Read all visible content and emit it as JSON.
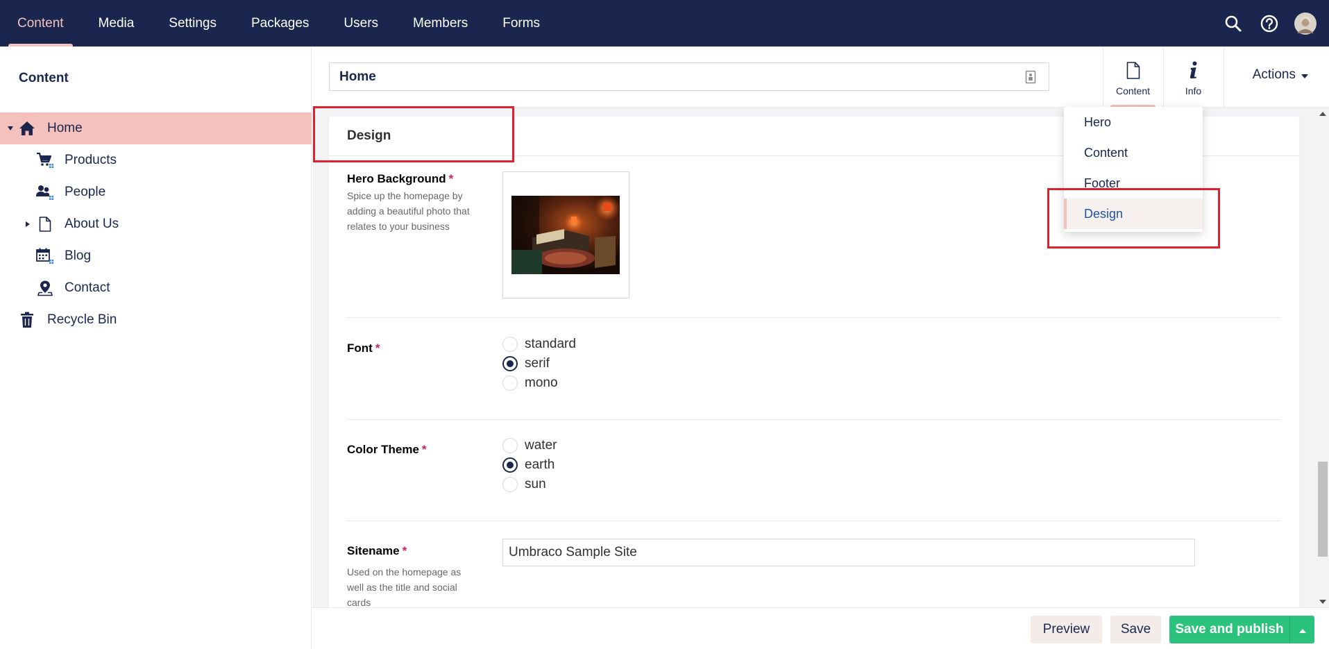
{
  "topnav": {
    "items": [
      {
        "label": "Content",
        "active": true
      },
      {
        "label": "Media"
      },
      {
        "label": "Settings"
      },
      {
        "label": "Packages"
      },
      {
        "label": "Users"
      },
      {
        "label": "Members"
      },
      {
        "label": "Forms"
      }
    ],
    "icons": [
      "search-icon",
      "help-icon",
      "user-avatar"
    ]
  },
  "sidebar": {
    "title": "Content",
    "tree": [
      {
        "label": "Home",
        "icon": "home-icon",
        "selected": true,
        "expanded": true
      },
      {
        "label": "Products",
        "icon": "shopping-cart-icon"
      },
      {
        "label": "People",
        "icon": "users-icon"
      },
      {
        "label": "About Us",
        "icon": "document-icon",
        "has_children": true
      },
      {
        "label": "Blog",
        "icon": "calendar-icon"
      },
      {
        "label": "Contact",
        "icon": "map-pin-icon"
      },
      {
        "label": "Recycle Bin",
        "icon": "trash-icon"
      }
    ]
  },
  "editor": {
    "node_name": "Home",
    "apps": [
      {
        "label": "Content",
        "icon": "document-icon",
        "active": true
      },
      {
        "label": "Info",
        "icon": "info-icon"
      }
    ],
    "actions_label": "Actions"
  },
  "group": {
    "title": "Design",
    "properties": {
      "hero_background": {
        "label": "Hero Background",
        "required": "*",
        "description": "Spice up the homepage by adding a beautiful photo that relates to your business"
      },
      "font": {
        "label": "Font",
        "required": "*",
        "options": [
          "standard",
          "serif",
          "mono"
        ],
        "selected": "serif"
      },
      "color_theme": {
        "label": "Color Theme",
        "required": "*",
        "options": [
          "water",
          "earth",
          "sun"
        ],
        "selected": "earth"
      },
      "sitename": {
        "label": "Sitename",
        "required": "*",
        "description": "Used on the homepage as well as the title and social cards",
        "value": "Umbraco Sample Site"
      }
    }
  },
  "dropdown": {
    "items": [
      "Hero",
      "Content",
      "Footer",
      "Design"
    ],
    "active": "Design"
  },
  "footer": {
    "preview": "Preview",
    "save": "Save",
    "save_publish": "Save and publish"
  },
  "colors": {
    "topbar": "#1b264f",
    "accent": "#f5c1bc",
    "publish": "#2bc37c",
    "highlight": "#e0212d",
    "required": "#d42054"
  }
}
